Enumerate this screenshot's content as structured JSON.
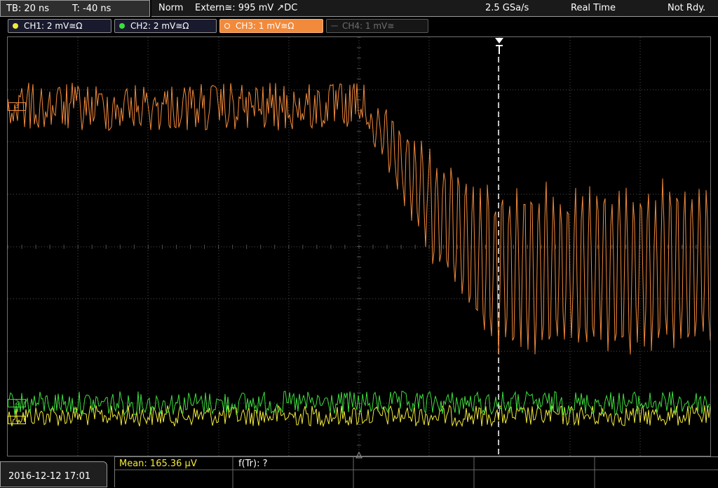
{
  "top": {
    "timebase": "TB: 20 ns",
    "trigger_time": "T: -40 ns",
    "trigger_mode": "Norm",
    "trigger_source": "Extern≅: 995 mV ↗DC",
    "sample_rate": "2.5 GSa/s",
    "acq_mode": "Real Time",
    "status": "Not Rdy."
  },
  "channels": [
    {
      "label": "CH1: 2 mV≅Ω",
      "color": "#f2ea3a",
      "active": true
    },
    {
      "label": "CH2: 2 mV≅Ω",
      "color": "#3ddc3d",
      "active": true
    },
    {
      "label": "CH3: 1 mV≅Ω",
      "color": "#f28a3c",
      "active": true,
      "selected": true
    },
    {
      "label": "CH4: 1 mV≅",
      "color": "#5a5a5a",
      "active": false
    }
  ],
  "markers": {
    "trigger_label": "T",
    "ch3_marker": "3",
    "ch2_marker": "2",
    "ch1_marker": "1"
  },
  "bottom": {
    "datetime": "2016-12-12 17:01",
    "mean": "Mean: 165.36 μV",
    "ftr": "f(Tr): ?"
  },
  "colors": {
    "ch1": "#f2ea3a",
    "ch2": "#3ddc3d",
    "ch3": "#f28a3c",
    "grid": "#505050"
  }
}
